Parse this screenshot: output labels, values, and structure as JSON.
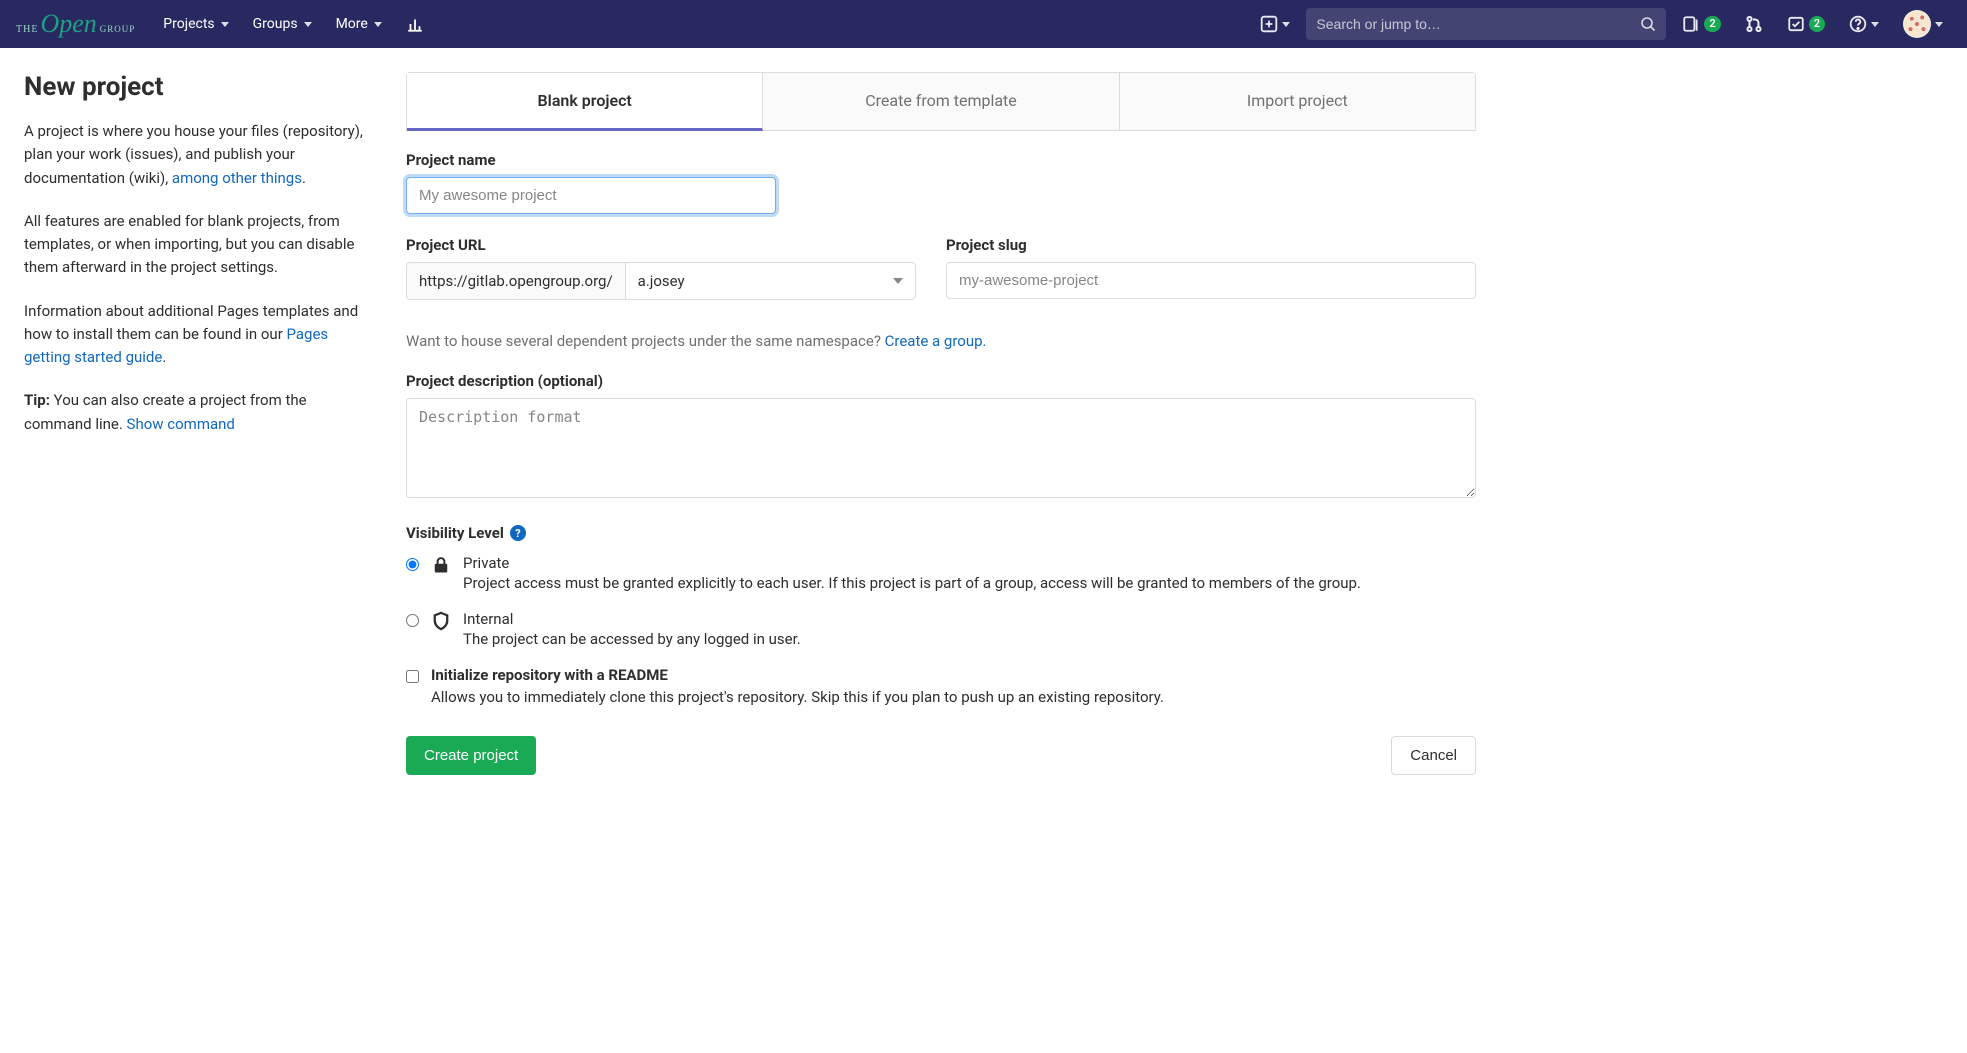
{
  "navbar": {
    "menu": {
      "projects": "Projects",
      "groups": "Groups",
      "more": "More"
    },
    "search_placeholder": "Search or jump to…",
    "issues_badge": "2",
    "todos_badge": "2"
  },
  "sidebar": {
    "heading": "New project",
    "p1_a": "A project is where you house your files (repository), plan your work (issues), and publish your documentation (wiki), ",
    "p1_link": "among other things",
    "p1_b": ".",
    "p2": "All features are enabled for blank projects, from templates, or when importing, but you can disable them afterward in the project settings.",
    "p3_a": "Information about additional Pages templates and how to install them can be found in our ",
    "p3_link": "Pages getting started guide",
    "p3_b": ".",
    "tip_label": "Tip:",
    "tip_a": " You can also create a project from the command line. ",
    "tip_link": "Show command"
  },
  "tabs": {
    "blank": "Blank project",
    "template": "Create from template",
    "import": "Import project"
  },
  "form": {
    "project_name_label": "Project name",
    "project_name_placeholder": "My awesome project",
    "project_url_label": "Project URL",
    "project_url_base": "https://gitlab.opengroup.org/",
    "project_url_namespace": "a.josey",
    "project_slug_label": "Project slug",
    "project_slug_placeholder": "my-awesome-project",
    "namespace_hint_a": "Want to house several dependent projects under the same namespace? ",
    "namespace_hint_link": "Create a group.",
    "desc_label": "Project description (optional)",
    "desc_placeholder": "Description format",
    "visibility_label": "Visibility Level",
    "vis_private_label": "Private",
    "vis_private_desc": "Project access must be granted explicitly to each user. If this project is part of a group, access will be granted to members of the group.",
    "vis_internal_label": "Internal",
    "vis_internal_desc": "The project can be accessed by any logged in user.",
    "readme_label": "Initialize repository with a README",
    "readme_desc": "Allows you to immediately clone this project's repository. Skip this if you plan to push up an existing repository.",
    "submit": "Create project",
    "cancel": "Cancel"
  }
}
